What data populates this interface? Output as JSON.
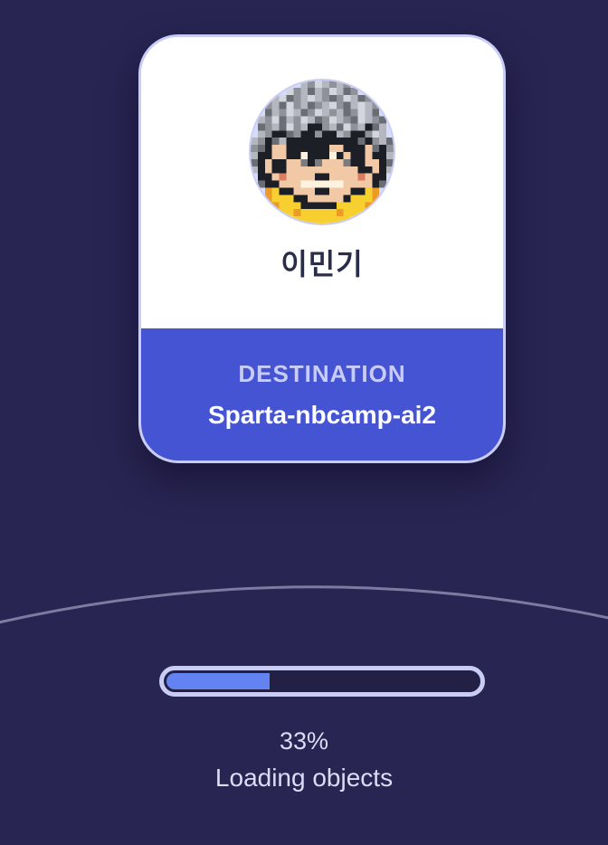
{
  "card": {
    "user_name": "이민기",
    "destination_label": "DESTINATION",
    "destination_value": "Sparta-nbcamp-ai2",
    "avatar_icon": "pixel-art-avatar"
  },
  "progress": {
    "percent_text": "33%",
    "fraction": 0.33,
    "status_text": "Loading objects"
  },
  "colors": {
    "background": "#282552",
    "card_accent": "#4554d3",
    "card_border": "#c9ccf5",
    "progress_fill": "#6383f0",
    "text_light": "#dcdcf6"
  }
}
